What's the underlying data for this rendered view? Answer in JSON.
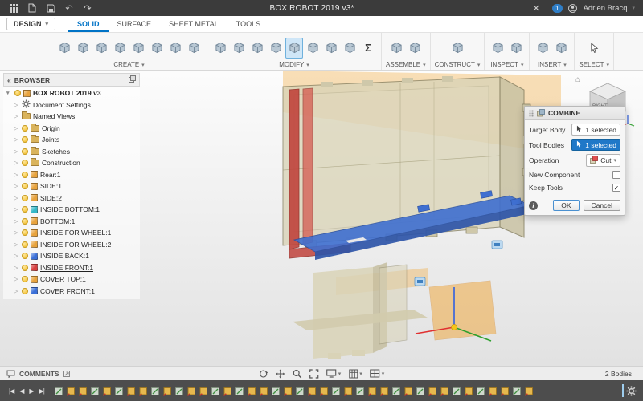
{
  "titlebar": {
    "title": "BOX ROBOT 2019 v3*",
    "close": "✕",
    "badge": "1",
    "user": "Adrien Bracq"
  },
  "menubar": {
    "design": "DESIGN",
    "tabs": [
      {
        "label": "SOLID",
        "active": true
      },
      {
        "label": "SURFACE",
        "active": false
      },
      {
        "label": "SHEET METAL",
        "active": false
      },
      {
        "label": "TOOLS",
        "active": false
      }
    ]
  },
  "toolbar": {
    "groups": [
      {
        "label": "CREATE",
        "icons": [
          "new-sketch",
          "create-form",
          "box",
          "extrude",
          "revolve",
          "sweep",
          "loft",
          "pattern"
        ],
        "active": ""
      },
      {
        "label": "MODIFY",
        "icons": [
          "press-pull",
          "fillet",
          "chamfer",
          "shell",
          "combine",
          "offset-face",
          "replace-face",
          "split-body",
          "change-parameters"
        ],
        "active": "combine"
      },
      {
        "label": "ASSEMBLE",
        "icons": [
          "new-component",
          "joint"
        ],
        "active": ""
      },
      {
        "label": "CONSTRUCT",
        "icons": [
          "construction-plane"
        ],
        "active": ""
      },
      {
        "label": "INSPECT",
        "icons": [
          "measure",
          "section-analysis"
        ],
        "active": ""
      },
      {
        "label": "INSERT",
        "icons": [
          "insert-derive",
          "decal"
        ],
        "active": ""
      },
      {
        "label": "SELECT",
        "icons": [
          "select"
        ],
        "active": ""
      }
    ]
  },
  "browser": {
    "collapse": "«",
    "header": "BROWSER",
    "root": "BOX ROBOT 2019 v3",
    "items": [
      {
        "label": "Document Settings",
        "icon": "gear",
        "bulb": false,
        "underline": false,
        "color": ""
      },
      {
        "label": "Named Views",
        "icon": "folder",
        "bulb": false,
        "underline": false,
        "color": ""
      },
      {
        "label": "Origin",
        "icon": "folder",
        "bulb": true,
        "underline": false,
        "color": ""
      },
      {
        "label": "Joints",
        "icon": "folder",
        "bulb": true,
        "underline": false,
        "color": ""
      },
      {
        "label": "Sketches",
        "icon": "folder",
        "bulb": true,
        "underline": false,
        "color": ""
      },
      {
        "label": "Construction",
        "icon": "folder",
        "bulb": true,
        "underline": false,
        "color": ""
      },
      {
        "label": "Rear:1",
        "icon": "component",
        "bulb": true,
        "underline": false,
        "color": "#e8a33d"
      },
      {
        "label": "SIDE:1",
        "icon": "component",
        "bulb": true,
        "underline": false,
        "color": "#e8a33d"
      },
      {
        "label": "SIDE:2",
        "icon": "component",
        "bulb": true,
        "underline": false,
        "color": "#e8a33d"
      },
      {
        "label": "INSIDE BOTTOM:1",
        "icon": "component",
        "bulb": true,
        "underline": true,
        "color": "#35b8c8"
      },
      {
        "label": "BOTTOM:1",
        "icon": "component",
        "bulb": true,
        "underline": false,
        "color": "#e8a33d"
      },
      {
        "label": "INSIDE FOR WHEEL:1",
        "icon": "component",
        "bulb": true,
        "underline": false,
        "color": "#e8a33d"
      },
      {
        "label": "INSIDE FOR WHEEL:2",
        "icon": "component",
        "bulb": true,
        "underline": false,
        "color": "#e8a33d"
      },
      {
        "label": "INSIDE BACK:1",
        "icon": "component",
        "bulb": true,
        "underline": false,
        "color": "#3a6fd8"
      },
      {
        "label": "INSIDE FRONT:1",
        "icon": "component",
        "bulb": true,
        "underline": true,
        "color": "#d84040"
      },
      {
        "label": "COVER TOP:1",
        "icon": "component",
        "bulb": true,
        "underline": false,
        "color": "#e8a33d"
      },
      {
        "label": "COVER FRONT:1",
        "icon": "component",
        "bulb": true,
        "underline": false,
        "color": "#3a6fd8"
      }
    ]
  },
  "viewport": {
    "viewcube_face": "RIGHT",
    "colors": {
      "body": "#d9d3b7",
      "target_highlight": "#c0443c",
      "tool_highlight": "#3f6fd0",
      "construction_plane": "#f0a535",
      "selection_accent": "#1f78c8"
    }
  },
  "dialog": {
    "title": "COMBINE",
    "fields": [
      {
        "label": "Target Body",
        "type": "select-field",
        "value": "1 selected",
        "active": false
      },
      {
        "label": "Tool Bodies",
        "type": "select-field",
        "value": "1 selected",
        "active": true
      },
      {
        "label": "Operation",
        "type": "dropdown",
        "value": "Cut"
      },
      {
        "label": "New Component",
        "type": "checkbox",
        "checked": false
      },
      {
        "label": "Keep Tools",
        "type": "checkbox",
        "checked": true
      }
    ],
    "ok": "OK",
    "cancel": "Cancel"
  },
  "navbar": {
    "comments_label": "COMMENTS",
    "status": "2 Bodies"
  },
  "timeline": {
    "controls": [
      "|◀",
      "◀",
      "▶",
      "▶|"
    ],
    "features": [
      "sketch",
      "component",
      "component",
      "sketch",
      "component",
      "sketch",
      "component",
      "component",
      "sketch",
      "component",
      "sketch",
      "component",
      "component",
      "sketch",
      "component",
      "sketch",
      "component",
      "component",
      "sketch",
      "component",
      "sketch",
      "component",
      "component",
      "sketch",
      "component",
      "sketch",
      "component",
      "component",
      "sketch",
      "component",
      "sketch",
      "component",
      "component",
      "sketch",
      "component",
      "sketch",
      "component",
      "component",
      "sketch",
      "component"
    ]
  }
}
